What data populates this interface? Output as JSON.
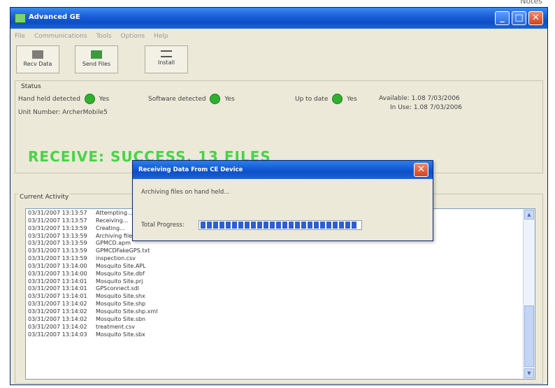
{
  "top_note": "Notes",
  "window": {
    "title": "Advanced GE"
  },
  "menu": [
    "File",
    "Communications",
    "Tools",
    "Options",
    "Help"
  ],
  "toolbar": [
    {
      "label": "Recv Data",
      "icon": "receive-data-icon"
    },
    {
      "label": "Send Files",
      "icon": "send-files-icon"
    },
    {
      "label": "Install",
      "icon": "install-icon"
    }
  ],
  "status": {
    "group_label": "Status",
    "handheld_label": "Hand held detected",
    "handheld_value": "Yes",
    "software_label": "Software detected",
    "software_value": "Yes",
    "uptodate_label": "Up to date",
    "uptodate_value": "Yes",
    "available": "Available: 1.08 7/03/2006",
    "inuse": "In Use: 1.08 7/03/2006",
    "unit_number": "Unit Number: ArcherMobile5",
    "result": "RECEIVE: SUCCESS, 13 FILES"
  },
  "activity": {
    "label": "Current Activity",
    "log": [
      {
        "time": "03/31/2007 13:13:57",
        "msg": "Attempting..."
      },
      {
        "time": "03/31/2007 13:13:57",
        "msg": "Receiving..."
      },
      {
        "time": "03/31/2007 13:13:59",
        "msg": "Creating..."
      },
      {
        "time": "03/31/2007 13:13:59",
        "msg": "Archiving files..."
      },
      {
        "time": "03/31/2007 13:13:59",
        "msg": "GPMCD.apm"
      },
      {
        "time": "03/31/2007 13:13:59",
        "msg": "GPMCDFakeGPS.txt"
      },
      {
        "time": "03/31/2007 13:13:59",
        "msg": "inspection.csv"
      },
      {
        "time": "03/31/2007 13:14:00",
        "msg": "Mosquito Site.APL"
      },
      {
        "time": "03/31/2007 13:14:00",
        "msg": "Mosquito Site.dbf"
      },
      {
        "time": "03/31/2007 13:14:01",
        "msg": "Mosquito Site.prj"
      },
      {
        "time": "03/31/2007 13:14:01",
        "msg": "GPSconnect.sdl"
      },
      {
        "time": "03/31/2007 13:14:01",
        "msg": "Mosquito Site.shx"
      },
      {
        "time": "03/31/2007 13:14:02",
        "msg": "Mosquito Site.shp"
      },
      {
        "time": "03/31/2007 13:14:02",
        "msg": "Mosquito Site.shp.xml"
      },
      {
        "time": "03/31/2007 13:14:02",
        "msg": "Mosquito Site.sbn"
      },
      {
        "time": "03/31/2007 13:14:02",
        "msg": "treatment.csv"
      },
      {
        "time": "03/31/2007 13:14:03",
        "msg": "Mosquito Site.sbx"
      }
    ]
  },
  "dialog": {
    "title": "Receiving Data From CE Device",
    "message": "Archiving files on hand held...",
    "progress_label": "Total Progress:",
    "progress_fraction": 0.98
  }
}
